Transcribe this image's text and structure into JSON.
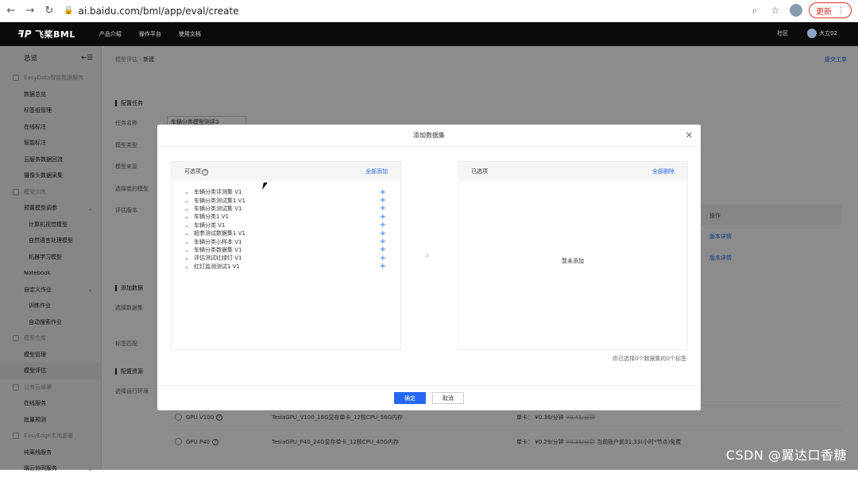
{
  "browser": {
    "url": "ai.baidu.com/bml/app/eval/create",
    "update_label": "更新"
  },
  "topbar": {
    "logo": "飞桨BML",
    "nav": [
      "产品介绍",
      "操作平台",
      "使用文档"
    ],
    "community": "社区",
    "user": "大立02"
  },
  "sidebar": {
    "title": "总览",
    "items": [
      {
        "label": "EasyData智能数据服务",
        "type": "group"
      },
      {
        "label": "数据总览",
        "type": "item"
      },
      {
        "label": "标签组管理",
        "type": "item"
      },
      {
        "label": "在线标注",
        "type": "item"
      },
      {
        "label": "智能标注",
        "type": "item"
      },
      {
        "label": "云服务数据回流",
        "type": "item"
      },
      {
        "label": "摄像头数据采集",
        "type": "item"
      },
      {
        "label": "模型训练",
        "type": "group"
      },
      {
        "label": "预置模型调参",
        "type": "item",
        "expand": true
      },
      {
        "label": "计算机视觉模型",
        "type": "sub"
      },
      {
        "label": "自然语言处理模型",
        "type": "sub"
      },
      {
        "label": "机器学习模型",
        "type": "sub"
      },
      {
        "label": "Notebook",
        "type": "item"
      },
      {
        "label": "自定义作业",
        "type": "item",
        "expand": true
      },
      {
        "label": "训练作业",
        "type": "sub"
      },
      {
        "label": "自动搜索作业",
        "type": "sub"
      },
      {
        "label": "模型仓库",
        "type": "group"
      },
      {
        "label": "模型管理",
        "type": "item"
      },
      {
        "label": "模型评估",
        "type": "item",
        "active": true
      },
      {
        "label": "公有云部署",
        "type": "group"
      },
      {
        "label": "在线服务",
        "type": "item"
      },
      {
        "label": "批量预测",
        "type": "item"
      },
      {
        "label": "EasyEdge本地部署",
        "type": "group"
      },
      {
        "label": "纯离线服务",
        "type": "item"
      },
      {
        "label": "端云协同服务",
        "type": "item",
        "expand": true
      }
    ]
  },
  "main": {
    "breadcrumb_parent": "模型评估",
    "breadcrumb_current": "新建",
    "submit_ticket": "提交工单",
    "sections": {
      "config_task": "配置任务",
      "add_data": "添加数据",
      "config_resource": "配置资源"
    },
    "labels": {
      "task_name": "任务名称",
      "model_type": "模型类型",
      "model_source": "模型来源",
      "select_model": "选择我的模型",
      "eval_version": "评估版本",
      "select_dataset": "选择数据集",
      "label_match": "标签匹配",
      "select_env": "选择运行环境"
    },
    "task_name_value": "车辆分类模型测评3",
    "table_header_op": "操作",
    "version_detail": "版本详情",
    "gpu_rows": [
      {
        "name": "GPU V100",
        "spec": "TeslaGPU_V100_16G显存单卡_12核CPU_56G内存",
        "price_label": "单卡：",
        "price": "¥0.36/分钟",
        "old_price": "¥0.45/分钟",
        "note": ""
      },
      {
        "name": "GPU P40",
        "spec": "TeslaGPU_P40_24G显存单卡_12核CPU_40G内存",
        "price_label": "单卡：",
        "price": "¥0.29/分钟",
        "old_price": "¥0.35/分钟",
        "note": "当前账户前31.33(小时*节点)免费"
      }
    ]
  },
  "modal": {
    "title": "添加数据集",
    "left_title": "可选项",
    "add_all": "全部添加",
    "right_title": "已选项",
    "delete_all": "全部删除",
    "empty_text": "暂未添加",
    "datasets": [
      "车辆分类评测集 V1",
      "车辆分类测试集1 V1",
      "车辆分类测试集 V1",
      "车辆分类1 V1",
      "车辆分类 V1",
      "超参测试数据集1 V1",
      "车辆分类小样本 V1",
      "车辆分类数据集 V1",
      "评估测试红绿灯 V1",
      "红灯监测测试1 V1"
    ],
    "selected_summary": "你已选择0个数据集的0个标签",
    "ok_label": "确定",
    "cancel_label": "取消"
  },
  "watermark": "CSDN @翼达口香糖"
}
